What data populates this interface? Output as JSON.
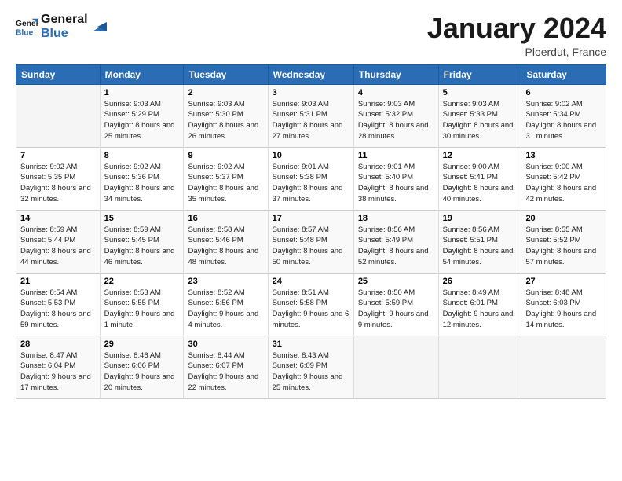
{
  "header": {
    "logo_line1": "General",
    "logo_line2": "Blue",
    "month": "January 2024",
    "location": "Ploerdut, France"
  },
  "days_of_week": [
    "Sunday",
    "Monday",
    "Tuesday",
    "Wednesday",
    "Thursday",
    "Friday",
    "Saturday"
  ],
  "weeks": [
    [
      {
        "num": "",
        "sunrise": "",
        "sunset": "",
        "daylight": ""
      },
      {
        "num": "1",
        "sunrise": "Sunrise: 9:03 AM",
        "sunset": "Sunset: 5:29 PM",
        "daylight": "Daylight: 8 hours and 25 minutes."
      },
      {
        "num": "2",
        "sunrise": "Sunrise: 9:03 AM",
        "sunset": "Sunset: 5:30 PM",
        "daylight": "Daylight: 8 hours and 26 minutes."
      },
      {
        "num": "3",
        "sunrise": "Sunrise: 9:03 AM",
        "sunset": "Sunset: 5:31 PM",
        "daylight": "Daylight: 8 hours and 27 minutes."
      },
      {
        "num": "4",
        "sunrise": "Sunrise: 9:03 AM",
        "sunset": "Sunset: 5:32 PM",
        "daylight": "Daylight: 8 hours and 28 minutes."
      },
      {
        "num": "5",
        "sunrise": "Sunrise: 9:03 AM",
        "sunset": "Sunset: 5:33 PM",
        "daylight": "Daylight: 8 hours and 30 minutes."
      },
      {
        "num": "6",
        "sunrise": "Sunrise: 9:02 AM",
        "sunset": "Sunset: 5:34 PM",
        "daylight": "Daylight: 8 hours and 31 minutes."
      }
    ],
    [
      {
        "num": "7",
        "sunrise": "Sunrise: 9:02 AM",
        "sunset": "Sunset: 5:35 PM",
        "daylight": "Daylight: 8 hours and 32 minutes."
      },
      {
        "num": "8",
        "sunrise": "Sunrise: 9:02 AM",
        "sunset": "Sunset: 5:36 PM",
        "daylight": "Daylight: 8 hours and 34 minutes."
      },
      {
        "num": "9",
        "sunrise": "Sunrise: 9:02 AM",
        "sunset": "Sunset: 5:37 PM",
        "daylight": "Daylight: 8 hours and 35 minutes."
      },
      {
        "num": "10",
        "sunrise": "Sunrise: 9:01 AM",
        "sunset": "Sunset: 5:38 PM",
        "daylight": "Daylight: 8 hours and 37 minutes."
      },
      {
        "num": "11",
        "sunrise": "Sunrise: 9:01 AM",
        "sunset": "Sunset: 5:40 PM",
        "daylight": "Daylight: 8 hours and 38 minutes."
      },
      {
        "num": "12",
        "sunrise": "Sunrise: 9:00 AM",
        "sunset": "Sunset: 5:41 PM",
        "daylight": "Daylight: 8 hours and 40 minutes."
      },
      {
        "num": "13",
        "sunrise": "Sunrise: 9:00 AM",
        "sunset": "Sunset: 5:42 PM",
        "daylight": "Daylight: 8 hours and 42 minutes."
      }
    ],
    [
      {
        "num": "14",
        "sunrise": "Sunrise: 8:59 AM",
        "sunset": "Sunset: 5:44 PM",
        "daylight": "Daylight: 8 hours and 44 minutes."
      },
      {
        "num": "15",
        "sunrise": "Sunrise: 8:59 AM",
        "sunset": "Sunset: 5:45 PM",
        "daylight": "Daylight: 8 hours and 46 minutes."
      },
      {
        "num": "16",
        "sunrise": "Sunrise: 8:58 AM",
        "sunset": "Sunset: 5:46 PM",
        "daylight": "Daylight: 8 hours and 48 minutes."
      },
      {
        "num": "17",
        "sunrise": "Sunrise: 8:57 AM",
        "sunset": "Sunset: 5:48 PM",
        "daylight": "Daylight: 8 hours and 50 minutes."
      },
      {
        "num": "18",
        "sunrise": "Sunrise: 8:56 AM",
        "sunset": "Sunset: 5:49 PM",
        "daylight": "Daylight: 8 hours and 52 minutes."
      },
      {
        "num": "19",
        "sunrise": "Sunrise: 8:56 AM",
        "sunset": "Sunset: 5:51 PM",
        "daylight": "Daylight: 8 hours and 54 minutes."
      },
      {
        "num": "20",
        "sunrise": "Sunrise: 8:55 AM",
        "sunset": "Sunset: 5:52 PM",
        "daylight": "Daylight: 8 hours and 57 minutes."
      }
    ],
    [
      {
        "num": "21",
        "sunrise": "Sunrise: 8:54 AM",
        "sunset": "Sunset: 5:53 PM",
        "daylight": "Daylight: 8 hours and 59 minutes."
      },
      {
        "num": "22",
        "sunrise": "Sunrise: 8:53 AM",
        "sunset": "Sunset: 5:55 PM",
        "daylight": "Daylight: 9 hours and 1 minute."
      },
      {
        "num": "23",
        "sunrise": "Sunrise: 8:52 AM",
        "sunset": "Sunset: 5:56 PM",
        "daylight": "Daylight: 9 hours and 4 minutes."
      },
      {
        "num": "24",
        "sunrise": "Sunrise: 8:51 AM",
        "sunset": "Sunset: 5:58 PM",
        "daylight": "Daylight: 9 hours and 6 minutes."
      },
      {
        "num": "25",
        "sunrise": "Sunrise: 8:50 AM",
        "sunset": "Sunset: 5:59 PM",
        "daylight": "Daylight: 9 hours and 9 minutes."
      },
      {
        "num": "26",
        "sunrise": "Sunrise: 8:49 AM",
        "sunset": "Sunset: 6:01 PM",
        "daylight": "Daylight: 9 hours and 12 minutes."
      },
      {
        "num": "27",
        "sunrise": "Sunrise: 8:48 AM",
        "sunset": "Sunset: 6:03 PM",
        "daylight": "Daylight: 9 hours and 14 minutes."
      }
    ],
    [
      {
        "num": "28",
        "sunrise": "Sunrise: 8:47 AM",
        "sunset": "Sunset: 6:04 PM",
        "daylight": "Daylight: 9 hours and 17 minutes."
      },
      {
        "num": "29",
        "sunrise": "Sunrise: 8:46 AM",
        "sunset": "Sunset: 6:06 PM",
        "daylight": "Daylight: 9 hours and 20 minutes."
      },
      {
        "num": "30",
        "sunrise": "Sunrise: 8:44 AM",
        "sunset": "Sunset: 6:07 PM",
        "daylight": "Daylight: 9 hours and 22 minutes."
      },
      {
        "num": "31",
        "sunrise": "Sunrise: 8:43 AM",
        "sunset": "Sunset: 6:09 PM",
        "daylight": "Daylight: 9 hours and 25 minutes."
      },
      {
        "num": "",
        "sunrise": "",
        "sunset": "",
        "daylight": ""
      },
      {
        "num": "",
        "sunrise": "",
        "sunset": "",
        "daylight": ""
      },
      {
        "num": "",
        "sunrise": "",
        "sunset": "",
        "daylight": ""
      }
    ]
  ]
}
